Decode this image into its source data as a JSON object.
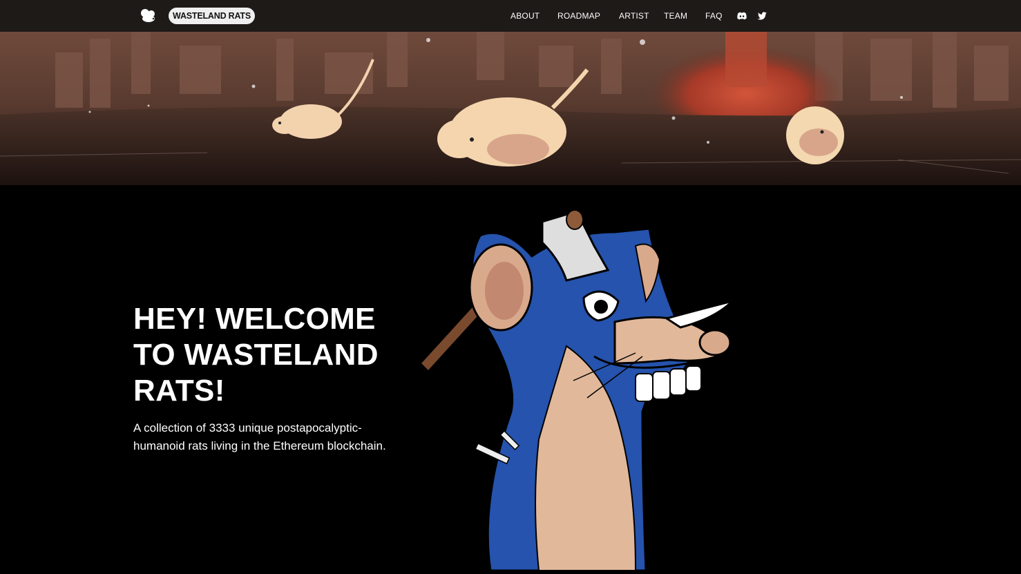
{
  "header": {
    "logo_icon": "rat-head-icon",
    "brand": "WASTELAND RATS",
    "nav": [
      {
        "label": "ABOUT"
      },
      {
        "label": "ROADMAP"
      },
      {
        "label": "ARTIST"
      },
      {
        "label": "TEAM"
      },
      {
        "label": "FAQ"
      }
    ],
    "social_icons": [
      "discord-icon",
      "twitter-icon"
    ]
  },
  "banner": {
    "image": "wasteland-rats-banner"
  },
  "hero": {
    "title": "HEY! WELCOME TO WASTELAND RATS!",
    "description": "A collection of 3333 unique postapocalyptic-humanoid rats living in the Ethereum blockchain.",
    "image": "blue-rat-with-axe"
  },
  "colors": {
    "background": "#000000",
    "navbar": "#201c1a",
    "brand_pill": "#efefef",
    "rat_blue": "#2553ad",
    "rat_skin": "#e2b89a"
  }
}
